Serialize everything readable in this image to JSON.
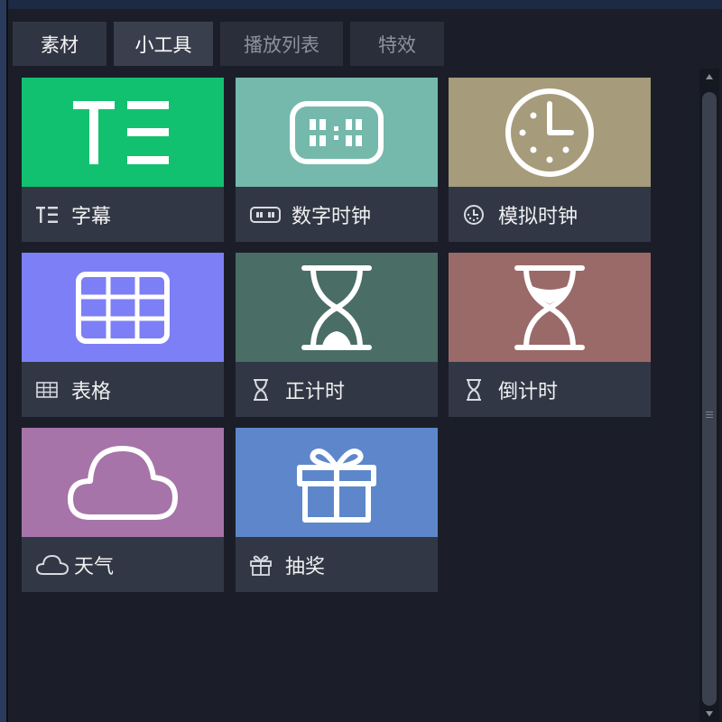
{
  "tabs": [
    {
      "label": "素材",
      "active": false
    },
    {
      "label": "小工具",
      "active": true
    },
    {
      "label": "播放列表",
      "active": false
    },
    {
      "label": "特效",
      "active": false
    }
  ],
  "tools": [
    {
      "label": "字幕",
      "icon": "text-icon",
      "color": "#11c16f"
    },
    {
      "label": "数字时钟",
      "icon": "digital-clock-icon",
      "color": "#74b9ac"
    },
    {
      "label": "模拟时钟",
      "icon": "analog-clock-icon",
      "color": "#a69b7a"
    },
    {
      "label": "表格",
      "icon": "table-icon",
      "color": "#7c7ff5"
    },
    {
      "label": "正计时",
      "icon": "hourglass-icon",
      "color": "#4a6d66"
    },
    {
      "label": "倒计时",
      "icon": "hourglass-icon",
      "color": "#9a6a68"
    },
    {
      "label": "天气",
      "icon": "cloud-icon",
      "color": "#a674a8"
    },
    {
      "label": "抽奖",
      "icon": "gift-icon",
      "color": "#5e87cb"
    }
  ]
}
